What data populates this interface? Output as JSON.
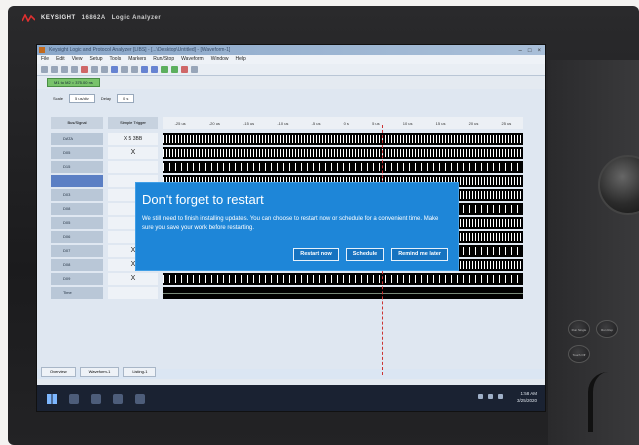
{
  "brand": {
    "logo": "KEYSIGHT",
    "model": "16862A",
    "subtitle": "Logic Analyzer"
  },
  "app": {
    "title": "Keysight Logic and Protocol Analyzer [LIBS] - [...\\Desktop\\Untitled] - [Waveform-1]",
    "menu": [
      "File",
      "Edit",
      "View",
      "Setup",
      "Tools",
      "Markers",
      "Run/Stop",
      "Waveform",
      "Window",
      "Help"
    ],
    "marker_readout": "M1 to M2 = 375.00 ns",
    "controls": {
      "scale_label": "Scale",
      "scale_value": "5 us/div",
      "delay_label": "Delay",
      "delay_value": "0 s"
    },
    "columns": {
      "bus_signal": "Bus/Signal",
      "simple_trigger": "Simple Trigger"
    },
    "ruler_ticks": [
      "-25 us",
      "-20 us",
      "-15 us",
      "-10 us",
      "-5 us",
      "0 s",
      "5 us",
      "10 us",
      "15 us",
      "20 us",
      "25 us"
    ],
    "rows": [
      {
        "name": "DATA",
        "trigger": "X 5 3BB"
      },
      {
        "name": "D05",
        "trigger": "X"
      },
      {
        "name": "D15",
        "trigger": ""
      },
      {
        "name": "",
        "trigger": ""
      },
      {
        "name": "D03",
        "trigger": ""
      },
      {
        "name": "D08",
        "trigger": ""
      },
      {
        "name": "D05",
        "trigger": ""
      },
      {
        "name": "D06",
        "trigger": ""
      },
      {
        "name": "D07",
        "trigger": "X"
      },
      {
        "name": "D08",
        "trigger": "X"
      },
      {
        "name": "D09",
        "trigger": "X"
      },
      {
        "name": "Time",
        "trigger": ""
      }
    ],
    "tabs": [
      "Overview",
      "Waveform-1",
      "Listing-1"
    ]
  },
  "dialog": {
    "title": "Don't forget to restart",
    "body": "We still need to finish installing updates. You can choose to restart now or schedule for a convenient time. Make sure you save your work before restarting.",
    "buttons": {
      "restart": "Restart now",
      "schedule": "Schedule",
      "remind": "Remind me later"
    }
  },
  "taskbar": {
    "time": "1:58 AM",
    "date": "3/25/2020"
  },
  "hardware_buttons": [
    "Run Single",
    "Run Rep",
    "Touch Off"
  ],
  "colors": {
    "dialog": "#1e86d8",
    "selected_row": "#5b7fc4",
    "marker": "#79c36b"
  }
}
